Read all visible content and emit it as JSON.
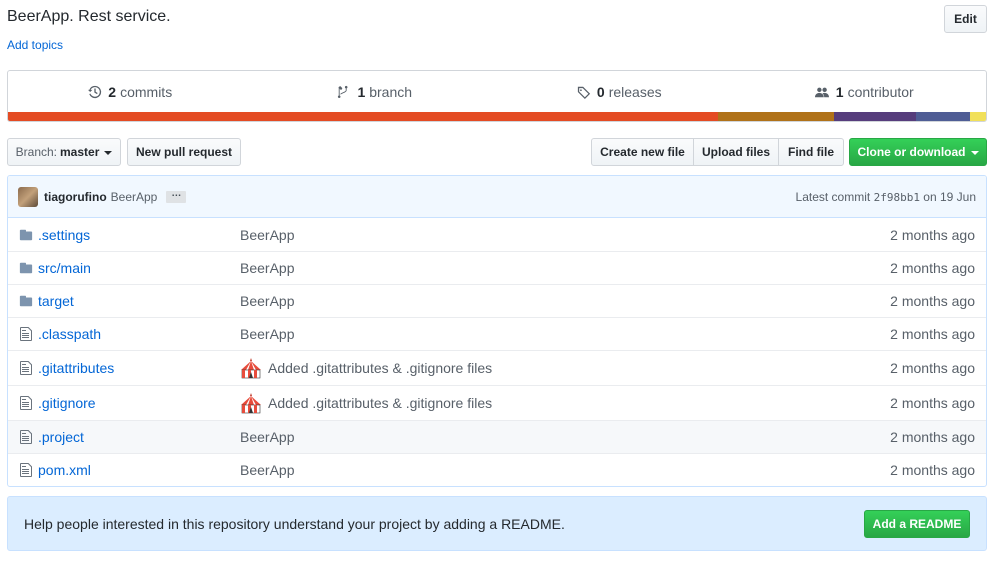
{
  "repo": {
    "description": "BeerApp. Rest service.",
    "add_topics": "Add topics",
    "edit_label": "Edit"
  },
  "summary": {
    "commits": {
      "num": "2",
      "label": "commits",
      "icon": "history-icon"
    },
    "branch": {
      "num": "1",
      "label": "branch",
      "icon": "branch-icon"
    },
    "releases": {
      "num": "0",
      "label": "releases",
      "icon": "tag-icon"
    },
    "contributor": {
      "num": "1",
      "label": "contributor",
      "icon": "people-icon"
    },
    "languages": [
      {
        "color": "#e44b23",
        "share": 72.6
      },
      {
        "color": "#b07219",
        "share": 11.9
      },
      {
        "color": "#563d7c",
        "share": 8.3
      },
      {
        "color": "#4f5d95",
        "share": 5.6
      },
      {
        "color": "#f1e05a",
        "share": 1.6
      }
    ]
  },
  "toolbar": {
    "branch_prefix": "Branch:",
    "branch_name": "master",
    "new_pr": "New pull request",
    "create_file": "Create new file",
    "upload_files": "Upload files",
    "find_file": "Find file",
    "clone": "Clone or download"
  },
  "commit": {
    "author": "tiagorufino",
    "message": "BeerApp",
    "ellipsis": "…",
    "latest_prefix": "Latest commit",
    "sha": "2f98bb1",
    "date": "on 19 Jun"
  },
  "files": [
    {
      "name": ".settings",
      "type": "dir",
      "message": "BeerApp",
      "age": "2 months ago"
    },
    {
      "name": "src/main",
      "type": "dir",
      "message": "BeerApp",
      "age": "2 months ago"
    },
    {
      "name": "target",
      "type": "dir",
      "message": "BeerApp",
      "age": "2 months ago"
    },
    {
      "name": ".classpath",
      "type": "file",
      "message": "BeerApp",
      "age": "2 months ago"
    },
    {
      "name": ".gitattributes",
      "type": "file",
      "message": "Added .gitattributes & .gitignore files",
      "age": "2 months ago",
      "emoji": "circus-tent-icon"
    },
    {
      "name": ".gitignore",
      "type": "file",
      "message": "Added .gitattributes & .gitignore files",
      "age": "2 months ago",
      "emoji": "circus-tent-icon"
    },
    {
      "name": ".project",
      "type": "file",
      "message": "BeerApp",
      "age": "2 months ago"
    },
    {
      "name": "pom.xml",
      "type": "file",
      "message": "BeerApp",
      "age": "2 months ago"
    }
  ],
  "readme": {
    "text": "Help people interested in this repository understand your project by adding a README.",
    "button": "Add a README"
  }
}
